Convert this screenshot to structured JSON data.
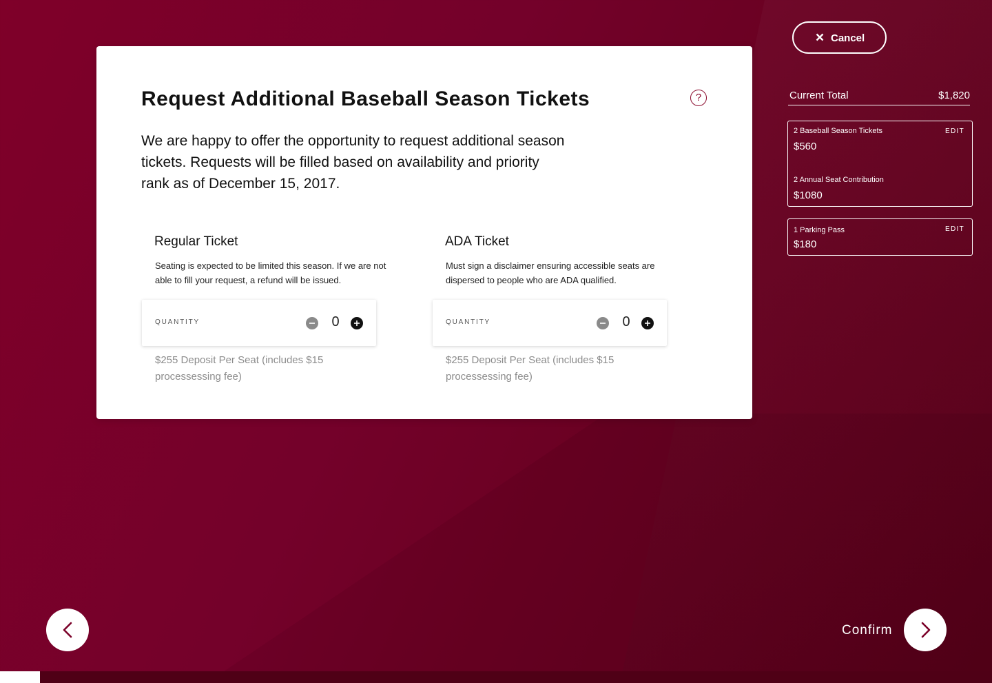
{
  "colors": {
    "background": "#7a0028",
    "accent": "#8a0a2c",
    "card": "#ffffff"
  },
  "card": {
    "title": "Request Additional Baseball Season Tickets",
    "help_icon": "question-circle-icon",
    "help_symbol": "?",
    "intro": "We are happy to offer the opportunity to request additional season tickets. Requests will be filled based on availability and priority rank as of December 15, 2017."
  },
  "tickets": [
    {
      "name": "Regular Ticket",
      "description": "Seating is expected to be limited this season. If we are not able to fill your request, a refund will be issued.",
      "quantity_label": "QUANTITY",
      "quantity": "0",
      "price_note": "$255 Deposit Per Seat (includes $15 processessing fee)"
    },
    {
      "name": "ADA Ticket",
      "description": "Must sign a disclaimer ensuring accessible seats are dispersed to people who are ADA qualified.",
      "quantity_label": "QUANTITY",
      "quantity": "0",
      "price_note": "$255 Deposit Per Seat (includes $15 processessing fee)"
    }
  ],
  "sidebar": {
    "cancel_label": "Cancel",
    "current_total_label": "Current Total",
    "current_total_value": "$1,820",
    "box1": {
      "edit_label": "EDIT",
      "items": [
        {
          "name": "2 Baseball Season Tickets",
          "price": "$560"
        },
        {
          "name": "2 Annual Seat Contribution",
          "price": "$1080"
        }
      ]
    },
    "box2": {
      "edit_label": "EDIT",
      "items": [
        {
          "name": "1 Parking Pass",
          "price": "$180"
        }
      ]
    }
  },
  "footer": {
    "back_icon": "chevron-left-icon",
    "next_icon": "chevron-right-icon",
    "confirm_label": "Confirm"
  }
}
